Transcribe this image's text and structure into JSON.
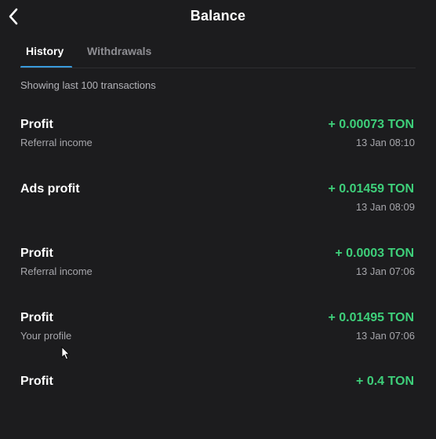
{
  "header": {
    "title": "Balance",
    "back_icon": "chevron-left-icon"
  },
  "tabs": [
    {
      "label": "History",
      "active": true
    },
    {
      "label": "Withdrawals",
      "active": false
    }
  ],
  "colors": {
    "background": "#1c1c1e",
    "accent": "#3a9bdc",
    "positive": "#3ecf7a",
    "muted": "#a6a6ab"
  },
  "subtitle": "Showing last 100 transactions",
  "transactions": [
    {
      "title": "Profit",
      "subtitle": "Referral income",
      "amount": "+ 0.00073 TON",
      "time": "13 Jan 08:10"
    },
    {
      "title": "Ads profit",
      "subtitle": "",
      "amount": "+ 0.01459 TON",
      "time": "13 Jan 08:09"
    },
    {
      "title": "Profit",
      "subtitle": "Referral income",
      "amount": "+ 0.0003 TON",
      "time": "13 Jan 07:06"
    },
    {
      "title": "Profit",
      "subtitle": "Your profile",
      "amount": "+ 0.01495 TON",
      "time": "13 Jan 07:06"
    },
    {
      "title": "Profit",
      "subtitle": "",
      "amount": "+ 0.4 TON",
      "time": ""
    }
  ]
}
